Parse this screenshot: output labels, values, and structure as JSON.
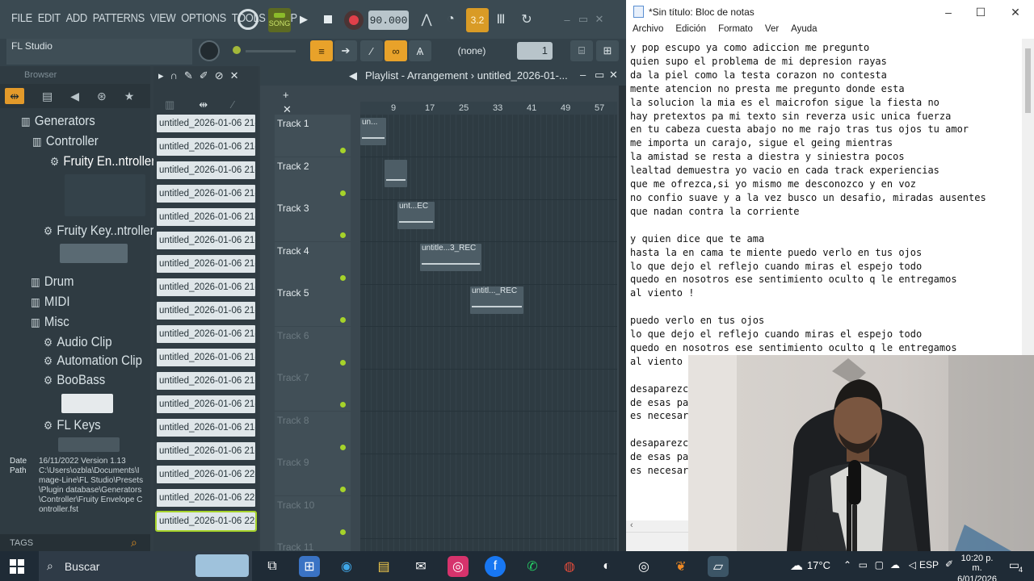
{
  "fl": {
    "menu": [
      "FILE",
      "EDIT",
      "ADD",
      "PATTERNS",
      "VIEW",
      "OPTIONS",
      "TOOLS",
      "HELP"
    ],
    "song_label": "SONG",
    "tempo": "90.000",
    "step": "3.2",
    "hint": "FL Studio",
    "pattern_selector": "(none)",
    "pattern_number": "1",
    "browser": {
      "title": "Browser",
      "tree": [
        {
          "label": "Generators",
          "level": 0,
          "kind": "folder"
        },
        {
          "label": "Controller",
          "level": 1,
          "kind": "folder"
        },
        {
          "label": "Fruity En..ntroller",
          "level": 2,
          "kind": "plugin",
          "selected": true
        },
        {
          "label": "Fruity Key..ntroller",
          "level": 2,
          "kind": "plugin"
        },
        {
          "label": "Drum",
          "level": 1,
          "kind": "folder"
        },
        {
          "label": "MIDI",
          "level": 1,
          "kind": "folder"
        },
        {
          "label": "Misc",
          "level": 1,
          "kind": "folder"
        },
        {
          "label": "Audio Clip",
          "level": 2,
          "kind": "plugin"
        },
        {
          "label": "Automation Clip",
          "level": 2,
          "kind": "plugin"
        },
        {
          "label": "BooBass",
          "level": 2,
          "kind": "plugin"
        },
        {
          "label": "FL Keys",
          "level": 2,
          "kind": "plugin"
        }
      ],
      "info": {
        "date_label": "Date",
        "date_value": "16/11/2022 Version 1.13",
        "path_label": "Path",
        "path_value": "C:\\Users\\ozbla\\Documents\\Image-Line\\FL Studio\\Presets\\Plugin database\\Generators\\Controller\\Fruity Envelope Controller.fst"
      },
      "tags_label": "TAGS"
    },
    "patterns": [
      "untitled_2026-01-06 21-...",
      "untitled_2026-01-06 21-...",
      "untitled_2026-01-06 21-...",
      "untitled_2026-01-06 21-...",
      "untitled_2026-01-06 21-...",
      "untitled_2026-01-06 21-...",
      "untitled_2026-01-06 21-...",
      "untitled_2026-01-06 21-...",
      "untitled_2026-01-06 21-...",
      "untitled_2026-01-06 21-...",
      "untitled_2026-01-06 21-...",
      "untitled_2026-01-06 21-...",
      "untitled_2026-01-06 21-...",
      "untitled_2026-01-06 21-...",
      "untitled_2026-01-06 21-...",
      "untitled_2026-01-06 22-...",
      "untitled_2026-01-06 22-...",
      "untitled_2026-01-06 22-..."
    ],
    "playlist": {
      "title": "Playlist - Arrangement",
      "file": "untitled_2026-01-...",
      "ruler": [
        "9",
        "17",
        "25",
        "33",
        "41",
        "49",
        "57"
      ],
      "tracks": [
        "Track 1",
        "Track 2",
        "Track 3",
        "Track 4",
        "Track 5",
        "Track 6",
        "Track 7",
        "Track 8",
        "Track 9",
        "Track 10",
        "Track 11"
      ],
      "clips": [
        "un...",
        "",
        "unt...EC",
        "untitle...3_REC",
        "untitl..._REC"
      ]
    }
  },
  "notepad": {
    "title": "*Sin título: Bloc de notas",
    "menu": [
      "Archivo",
      "Edición",
      "Formato",
      "Ver",
      "Ayuda"
    ],
    "text": "y pop escupo ya como adiccion me pregunto\nquien supo el problema de mi depresion rayas\nda la piel como la testa corazon no contesta\nmente atencion no presta me pregunto donde esta\nla solucion la mia es el maicrofon sigue la fiesta no\nhay pretextos pa mi texto sin reverza usic unica fuerza\nen tu cabeza cuesta abajo no me rajo tras tus ojos tu amor\nme importa un carajo, sigue el geing mientras\nla amistad se resta a diestra y siniestra pocos\nlealtad demuestra yo vacio en cada track experiencias\nque me ofrezca,si yo mismo me desconozco y en voz\nno confio suave y a la vez busco un desafio, miradas ausentes\nque nadan contra la corriente\n\ny quien dice que te ama\nhasta la en cama te miente puedo verlo en tus ojos\nlo que dejo el reflejo cuando miras el espejo todo\nquedo en nosotros ese sentimiento oculto q le entregamos\nal viento !\n\npuedo verlo en tus ojos\nlo que dejo el reflejo cuando miras el espejo todo\nquedo en nosotros ese sentimiento oculto q le entregamos\nal viento\n\ndesaparezc\nde esas pa\nes necesar\n\ndesaparezc\nde esas pa\nes necesar"
  },
  "taskbar": {
    "search_placeholder": "Buscar",
    "temperature": "17°C",
    "language": "ESP",
    "time": "10:20 p. m.",
    "date": "6/01/2026",
    "notifications": "4"
  }
}
